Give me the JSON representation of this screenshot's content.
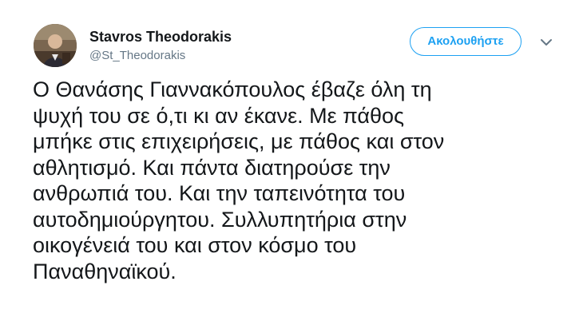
{
  "tweet": {
    "author": {
      "name": "Stavros Theodorakis",
      "handle": "@St_Theodorakis",
      "avatar_icon": "user-avatar-photo"
    },
    "follow_button_label": "Ακολουθήστε",
    "menu_icon": "chevron-down-icon",
    "text": "Ο Θανάσης Γιαννακόπουλος έβαζε όλη τη\nψυχή του σε ό,τι κι αν έκανε. Με πάθος\nμπήκε στις επιχειρήσεις, με πάθος και στον\nαθλητισμό. Και πάντα διατηρούσε την\nανθρωπιά του. Και την ταπεινότητα του\nαυτοδημιούργητου. Συλλυπητήρια στην\nοικογένειά του και στον κόσμο του\nΠαναθηναϊκού."
  },
  "colors": {
    "accent": "#1da1f2",
    "text": "#14171a",
    "secondary_text": "#657786",
    "background": "#ffffff"
  }
}
